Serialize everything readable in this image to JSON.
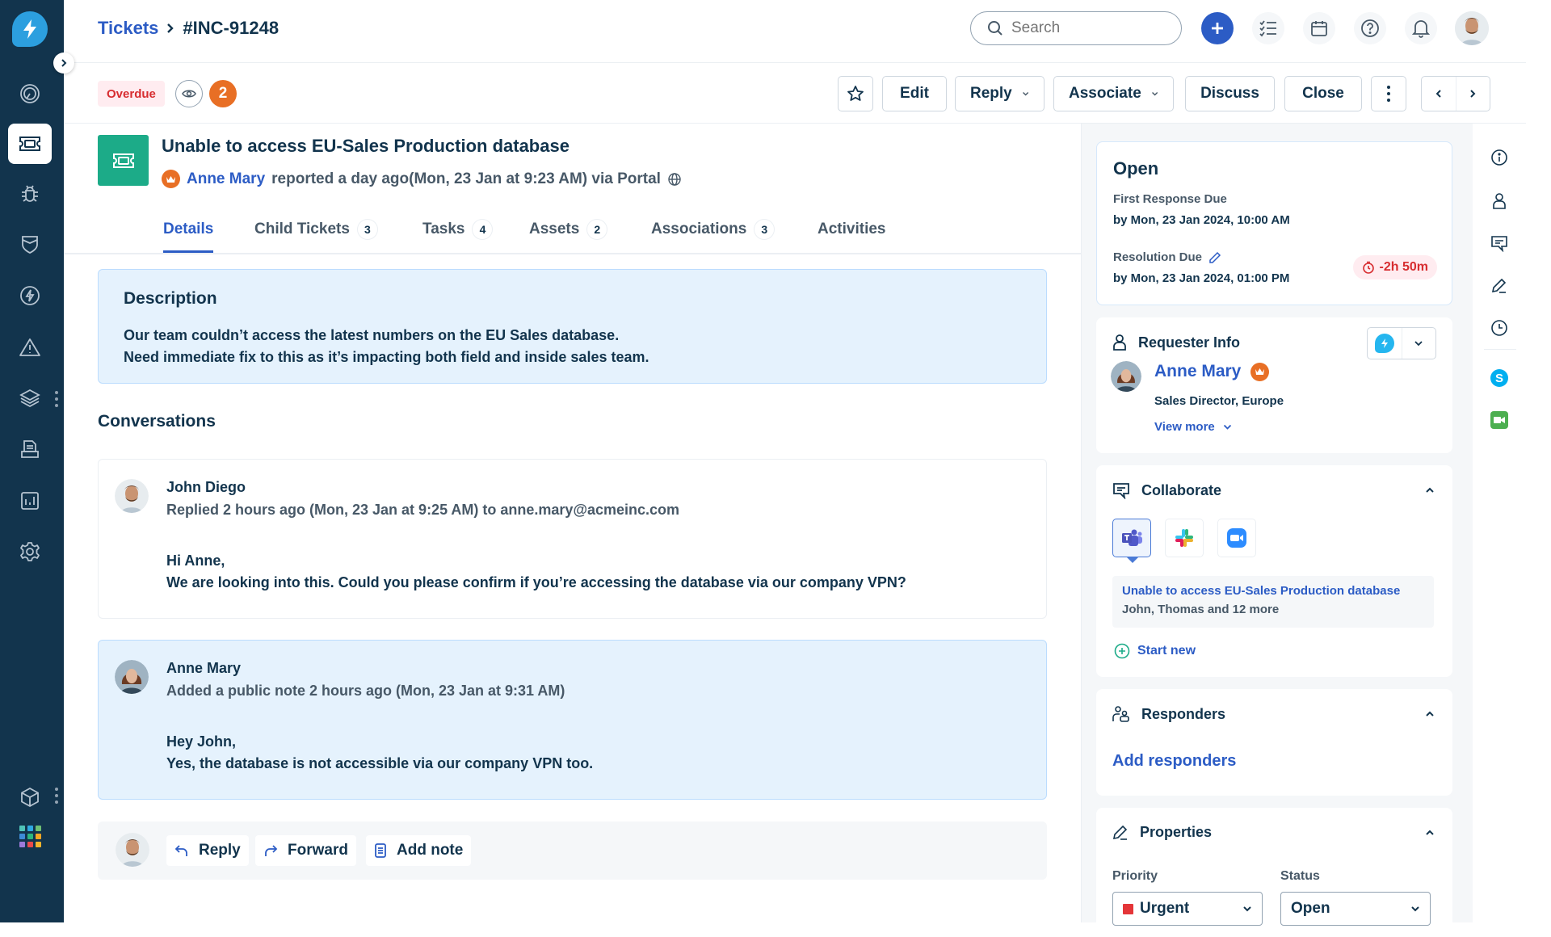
{
  "app": {
    "name": "Freshservice"
  },
  "breadcrumb": {
    "parent": "Tickets",
    "separator": ">",
    "current": "#INC-91248"
  },
  "search": {
    "placeholder": "Search"
  },
  "header_icons": [
    "add-icon",
    "checklist-icon",
    "calendar-icon",
    "help-icon",
    "bell-icon",
    "user-avatar"
  ],
  "sidebar": {
    "items": [
      {
        "name": "dashboard",
        "icon": "gauge-icon"
      },
      {
        "name": "tickets",
        "icon": "ticket-icon",
        "active": true
      },
      {
        "name": "problems",
        "icon": "bug-icon"
      },
      {
        "name": "changes",
        "icon": "shield-icon"
      },
      {
        "name": "releases",
        "icon": "bolt-icon"
      },
      {
        "name": "alerts",
        "icon": "warning-icon"
      },
      {
        "name": "assets",
        "icon": "layers-icon"
      },
      {
        "name": "solutions",
        "icon": "document-icon"
      },
      {
        "name": "reports",
        "icon": "chart-icon"
      },
      {
        "name": "admin",
        "icon": "gear-icon"
      },
      {
        "name": "apps",
        "icon": "cube-icon"
      },
      {
        "name": "app-switcher",
        "icon": "grid-icon"
      }
    ]
  },
  "toolbar": {
    "overdue_label": "Overdue",
    "watchers_count": "2",
    "edit_label": "Edit",
    "reply_label": "Reply",
    "associate_label": "Associate",
    "discuss_label": "Discuss",
    "close_label": "Close",
    "more_glyph": "⋮",
    "prev_glyph": "‹",
    "next_glyph": "›",
    "chevron": "⌄"
  },
  "ticket": {
    "title": "Unable to access EU-Sales Production database",
    "requester": "Anne Mary",
    "reported_text": "reported a day ago(Mon, 23 Jan at 9:23 AM) via Portal"
  },
  "tabs": [
    {
      "label": "Details",
      "active": true
    },
    {
      "label": "Child Tickets",
      "count": "3"
    },
    {
      "label": "Tasks",
      "count": "4"
    },
    {
      "label": "Assets",
      "count": "2"
    },
    {
      "label": "Associations",
      "count": "3"
    },
    {
      "label": "Activities"
    }
  ],
  "description": {
    "heading": "Description",
    "lines": [
      "Our team couldn’t access the latest numbers on the EU Sales database.",
      "Need immediate fix to this as it’s impacting both field and inside sales team."
    ]
  },
  "conversations": {
    "heading": "Conversations",
    "items": [
      {
        "author": "John Diego",
        "meta": "Replied 2 hours ago (Mon, 23 Jan at 9:25 AM) to anne.mary@acmeinc.com",
        "body": [
          "Hi Anne,",
          "We are looking into this. Could you please confirm if you’re accessing the database via our company VPN?"
        ],
        "type": "reply"
      },
      {
        "author": "Anne Mary",
        "meta": "Added a public note 2 hours ago (Mon, 23 Jan at 9:31 AM)",
        "body": [
          "Hey John,",
          "Yes, the database is not accessible via our company VPN too."
        ],
        "type": "note"
      }
    ]
  },
  "reply_bar": {
    "reply": "Reply",
    "forward": "Forward",
    "add_note": "Add note"
  },
  "sla": {
    "status": "Open",
    "first_response_label": "First Response Due",
    "first_response_value": "by Mon, 23 Jan 2024, 10:00 AM",
    "resolution_label": "Resolution Due",
    "resolution_value": "by Mon, 23 Jan 2024, 01:00 PM",
    "overdue_by": "-2h 50m"
  },
  "requester_info": {
    "heading": "Requester Info",
    "name": "Anne Mary",
    "title": "Sales Director, Europe",
    "view_more": "View more"
  },
  "collaborate": {
    "heading": "Collaborate",
    "apps": [
      "teams",
      "slack",
      "zoom"
    ],
    "thread_title": "Unable to access EU-Sales Production database",
    "thread_members": "John, Thomas and 12 more",
    "start_new": "Start new"
  },
  "responders": {
    "heading": "Responders",
    "add_label": "Add responders"
  },
  "properties": {
    "heading": "Properties",
    "priority_label": "Priority",
    "priority_value": "Urgent",
    "priority_color": "#e43538",
    "status_label": "Status",
    "status_value": "Open"
  },
  "rail_icons": [
    "info-icon",
    "person-icon",
    "comment-icon",
    "edit-icon",
    "clock-icon",
    "skype-icon",
    "video-icon"
  ],
  "colors": {
    "sidebar": "#12344d",
    "accent": "#2c5cc5",
    "ticket_green": "#1cab88",
    "overdue_red": "#d72d30",
    "crown_orange": "#e86f25"
  }
}
